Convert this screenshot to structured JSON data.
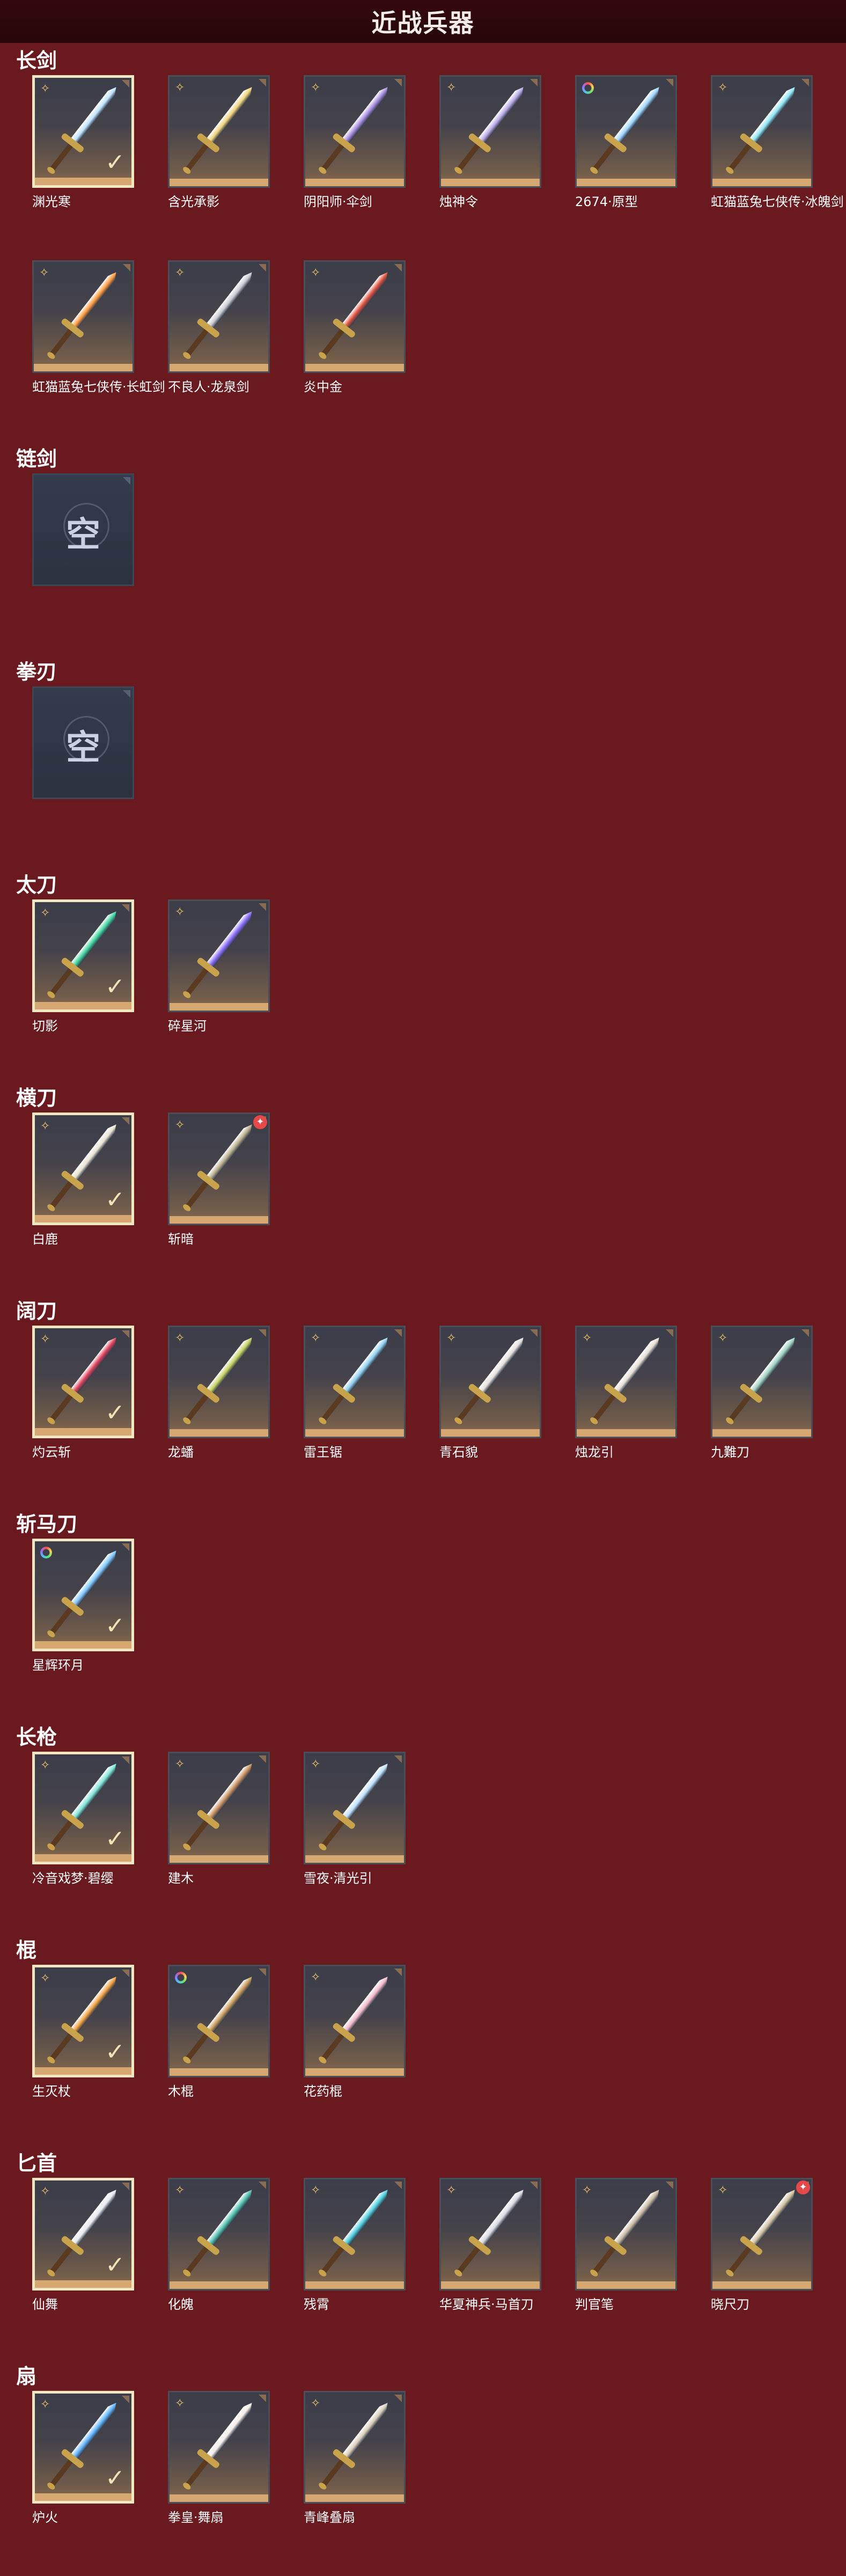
{
  "header": {
    "title": "近战兵器"
  },
  "colors": {
    "background": "#6a1a1f",
    "header": "#2b070a",
    "accent_gold": "#d6a770",
    "rarity_gold": "#f2c86a",
    "new_badge": "#e44848"
  },
  "empty_label": "空",
  "categories": [
    {
      "title": "长剑",
      "items": [
        {
          "name": "渊光寒",
          "rarity": "gold",
          "selected": true,
          "blade": "#bfe3ff"
        },
        {
          "name": "含光承影",
          "rarity": "gold",
          "selected": false,
          "blade": "#f0d27a"
        },
        {
          "name": "阴阳师·伞剑",
          "rarity": "gold",
          "selected": false,
          "blade": "#a78be0"
        },
        {
          "name": "烛神令",
          "rarity": "gold",
          "selected": false,
          "blade": "#b9a8e6"
        },
        {
          "name": "2674·原型",
          "rarity": "rainbow",
          "selected": false,
          "blade": "#9fd6ff"
        },
        {
          "name": "虹猫蓝兔七侠传·冰魄剑",
          "rarity": "gold",
          "selected": false,
          "blade": "#8ee6f5"
        },
        {
          "name": "虹猫蓝兔七侠传·长虹剑",
          "rarity": "gold",
          "selected": false,
          "blade": "#ff9a3c"
        },
        {
          "name": "不良人·龙泉剑",
          "rarity": "gold",
          "selected": false,
          "blade": "#c8c8d0"
        },
        {
          "name": "炎中金",
          "rarity": "gold",
          "selected": false,
          "blade": "#e0503c"
        }
      ]
    },
    {
      "title": "链剑",
      "items": [],
      "empty": true
    },
    {
      "title": "拳刃",
      "items": [],
      "empty": true
    },
    {
      "title": "太刀",
      "items": [
        {
          "name": "切影",
          "rarity": "gold",
          "selected": true,
          "blade": "#3fd6a0"
        },
        {
          "name": "碎星河",
          "rarity": "gold",
          "selected": false,
          "blade": "#8a6cff"
        }
      ]
    },
    {
      "title": "横刀",
      "items": [
        {
          "name": "白鹿",
          "rarity": "gold",
          "selected": true,
          "blade": "#e8e2d0"
        },
        {
          "name": "斩暗",
          "rarity": "gold",
          "selected": false,
          "blade": "#b8ad8a",
          "badge": "new"
        }
      ]
    },
    {
      "title": "阔刀",
      "items": [
        {
          "name": "灼云斩",
          "rarity": "gold",
          "selected": true,
          "blade": "#e0405a"
        },
        {
          "name": "龙蟠",
          "rarity": "gold",
          "selected": false,
          "blade": "#c4d060"
        },
        {
          "name": "雷王锯",
          "rarity": "gold",
          "selected": false,
          "blade": "#8fd0f0"
        },
        {
          "name": "青石貌",
          "rarity": "gold",
          "selected": false,
          "blade": "#e4e0dc"
        },
        {
          "name": "烛龙引",
          "rarity": "gold",
          "selected": false,
          "blade": "#e6ddd2"
        },
        {
          "name": "九難刀",
          "rarity": "gold",
          "selected": false,
          "blade": "#9ed0c0"
        }
      ]
    },
    {
      "title": "斩马刀",
      "items": [
        {
          "name": "星辉环月",
          "rarity": "rainbow",
          "selected": true,
          "blade": "#7fc8ff"
        }
      ]
    },
    {
      "title": "长枪",
      "items": [
        {
          "name": "冷音戏梦·碧缨",
          "rarity": "gold",
          "selected": true,
          "blade": "#7fe6d8"
        },
        {
          "name": "建木",
          "rarity": "gold",
          "selected": false,
          "blade": "#c89060"
        },
        {
          "name": "雪夜·清光引",
          "rarity": "gold",
          "selected": false,
          "blade": "#bfe2ff"
        }
      ]
    },
    {
      "title": "棍",
      "items": [
        {
          "name": "生灭杖",
          "rarity": "gold",
          "selected": true,
          "blade": "#f0a040"
        },
        {
          "name": "木棍",
          "rarity": "rainbow",
          "selected": false,
          "blade": "#c89a58"
        },
        {
          "name": "花药棍",
          "rarity": "gold",
          "selected": false,
          "blade": "#f2b8c8"
        }
      ]
    },
    {
      "title": "匕首",
      "items": [
        {
          "name": "仙舞",
          "rarity": "gold",
          "selected": true,
          "blade": "#e8e8ee"
        },
        {
          "name": "化魄",
          "rarity": "gold",
          "selected": false,
          "blade": "#4fc0b0"
        },
        {
          "name": "残霄",
          "rarity": "gold",
          "selected": false,
          "blade": "#4fd0e0"
        },
        {
          "name": "华夏神兵·马首刀",
          "rarity": "gold",
          "selected": false,
          "blade": "#d8d8e0"
        },
        {
          "name": "判官笔",
          "rarity": "gold",
          "selected": false,
          "blade": "#c8b8a0"
        },
        {
          "name": "晓尺刀",
          "rarity": "gold",
          "selected": false,
          "blade": "#d0c0a0",
          "badge": "new"
        }
      ]
    },
    {
      "title": "扇",
      "items": [
        {
          "name": "炉火",
          "rarity": "gold",
          "selected": true,
          "blade": "#5fb4ff"
        },
        {
          "name": "拳皇·舞扇",
          "rarity": "gold",
          "selected": false,
          "blade": "#f4ece8"
        },
        {
          "name": "青峰叠扇",
          "rarity": "gold",
          "selected": false,
          "blade": "#d8ccb8"
        }
      ]
    }
  ]
}
